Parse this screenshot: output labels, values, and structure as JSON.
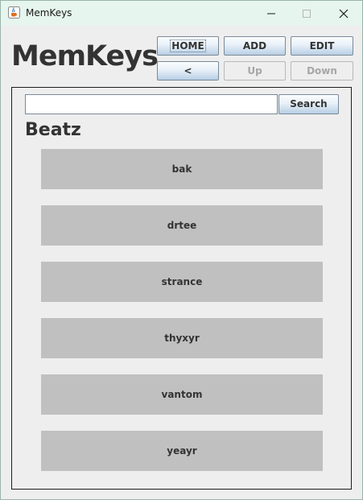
{
  "window": {
    "title": "MemKeys"
  },
  "header": {
    "app_title": "MemKeys"
  },
  "toolbar": {
    "home_label": "HOME",
    "add_label": "ADD",
    "edit_label": "EDIT",
    "back_label": "<",
    "up_label": "Up",
    "down_label": "Down"
  },
  "search": {
    "value": "",
    "placeholder": "",
    "button_label": "Search"
  },
  "section": {
    "title": "Beatz"
  },
  "items": [
    {
      "label": "bak"
    },
    {
      "label": "drtee"
    },
    {
      "label": "strance"
    },
    {
      "label": "thyxyr"
    },
    {
      "label": "vantom"
    },
    {
      "label": "yeayr"
    }
  ]
}
